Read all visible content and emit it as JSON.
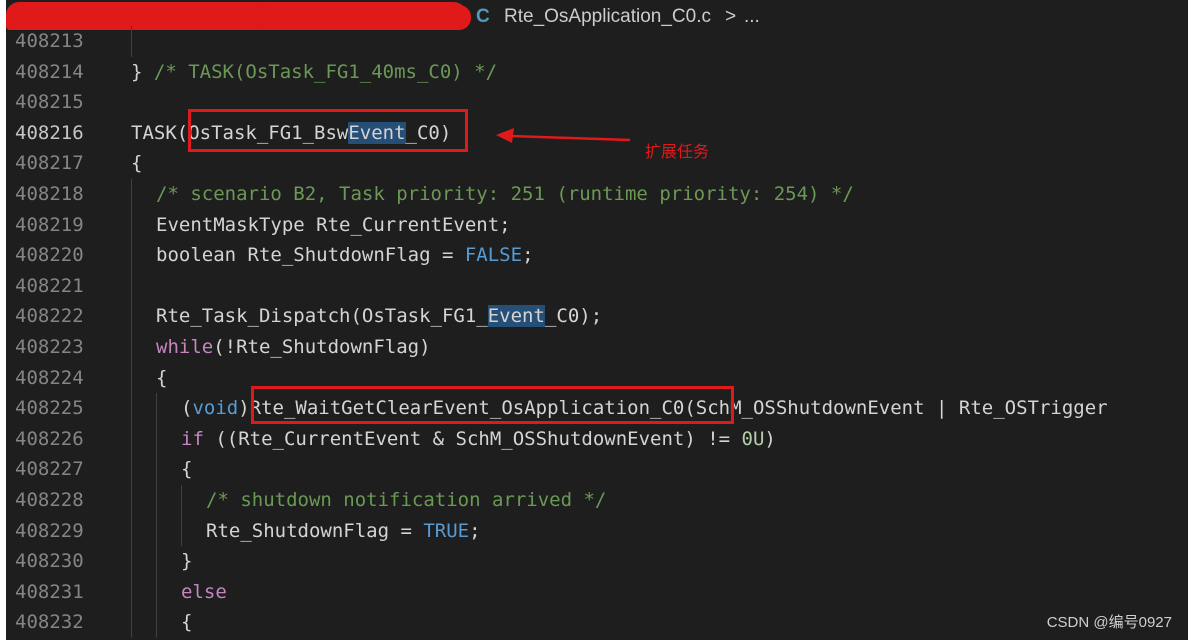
{
  "breadcrumb": {
    "lang_icon": "C",
    "file_name": "Rte_OsApplication_C0.c",
    "separator": ">",
    "more": "..."
  },
  "lines": [
    {
      "n": "408213",
      "code": "",
      "indent": 1
    },
    {
      "n": "408214",
      "code": "} /* TASK(OsTask_FG1_40ms_C0) */",
      "indent": 0
    },
    {
      "n": "408215",
      "code": "",
      "indent": 0
    },
    {
      "n": "408216",
      "code": "TASK(OsTask_FG1_BswEvent_C0)",
      "indent": 0
    },
    {
      "n": "408217",
      "code": "{",
      "indent": 0
    },
    {
      "n": "408218",
      "code": "/* scenario B2, Task priority: 251 (runtime priority: 254) */",
      "indent": 1
    },
    {
      "n": "408219",
      "code": "EventMaskType Rte_CurrentEvent;",
      "indent": 1
    },
    {
      "n": "408220",
      "code": "boolean Rte_ShutdownFlag = FALSE;",
      "indent": 1
    },
    {
      "n": "408221",
      "code": "",
      "indent": 1
    },
    {
      "n": "408222",
      "code": "Rte_Task_Dispatch(OsTask_FG1_BswEvent_C0);",
      "indent": 1
    },
    {
      "n": "408223",
      "code": "while(!Rte_ShutdownFlag)",
      "indent": 1
    },
    {
      "n": "408224",
      "code": "{",
      "indent": 1
    },
    {
      "n": "408225",
      "code": "(void)Rte_WaitGetClearEvent_OsApplication_C0(SchM_OSShutdownEvent | Rte_OSTrigger",
      "indent": 2
    },
    {
      "n": "408226",
      "code": "if ((Rte_CurrentEvent & SchM_OSShutdownEvent) != 0U)",
      "indent": 2
    },
    {
      "n": "408227",
      "code": "{",
      "indent": 2
    },
    {
      "n": "408228",
      "code": "/* shutdown notification arrived */",
      "indent": 3
    },
    {
      "n": "408229",
      "code": "Rte_ShutdownFlag = TRUE;",
      "indent": 3
    },
    {
      "n": "408230",
      "code": "}",
      "indent": 2
    },
    {
      "n": "408231",
      "code": "else",
      "indent": 2
    },
    {
      "n": "408232",
      "code": "{",
      "indent": 2
    }
  ],
  "annotation": "扩展任务",
  "watermark": "CSDN @编号0927",
  "colors": {
    "background": "#1e1e1e",
    "keyword": "#c586c0",
    "constant": "#569cd6",
    "comment": "#6a9955",
    "number": "#b5cea8",
    "annotation_red": "#e0191b"
  }
}
